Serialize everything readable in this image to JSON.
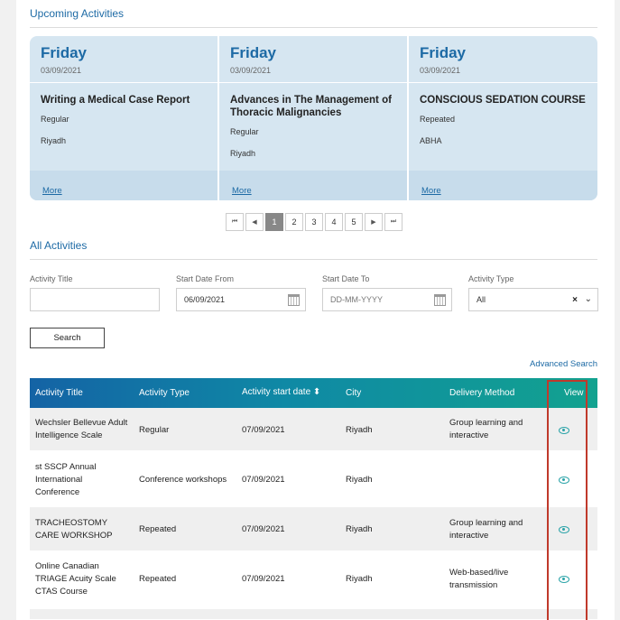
{
  "upcoming": {
    "title": "Upcoming Activities",
    "cards": [
      {
        "day": "Friday",
        "date": "03/09/2021",
        "title": "Writing a Medical Case Report",
        "type": "Regular",
        "city": "Riyadh",
        "more": "More"
      },
      {
        "day": "Friday",
        "date": "03/09/2021",
        "title": "Advances in The Management of Thoracic Malignancies",
        "type": "Regular",
        "city": "Riyadh",
        "more": "More"
      },
      {
        "day": "Friday",
        "date": "03/09/2021",
        "title": "CONSCIOUS SEDATION COURSE",
        "type": "Repeated",
        "city": "ABHA",
        "more": "More"
      }
    ]
  },
  "pagination": {
    "first": "⏮",
    "prev": "◀",
    "pages": [
      "1",
      "2",
      "3",
      "4",
      "5"
    ],
    "active_page": "1",
    "next": "▶",
    "last": "⏭"
  },
  "all": {
    "title": "All Activities",
    "filters": {
      "activity_title_label": "Activity Title",
      "activity_title_value": "",
      "start_from_label": "Start Date From",
      "start_from_value": "06/09/2021",
      "start_to_label": "Start Date To",
      "start_to_placeholder": "DD-MM-YYYY",
      "type_label": "Activity Type",
      "type_value": "All",
      "search_button": "Search",
      "advanced_search": "Advanced Search"
    },
    "table": {
      "headers": [
        "Activity Title",
        "Activity Type",
        "Activity start date ⬍",
        "City",
        "Delivery Method",
        "View"
      ],
      "rows": [
        {
          "title": "Wechsler Bellevue Adult Intelligence Scale",
          "type": "Regular",
          "date": "07/09/2021",
          "city": "Riyadh",
          "delivery": "Group learning and interactive"
        },
        {
          "title": "st SSCP Annual International Conference",
          "type": "Conference workshops",
          "date": "07/09/2021",
          "city": "Riyadh",
          "delivery": ""
        },
        {
          "title": "TRACHEOSTOMY CARE WORKSHOP",
          "type": "Repeated",
          "date": "07/09/2021",
          "city": "Riyadh",
          "delivery": "Group learning and interactive"
        },
        {
          "title": "Online Canadian TRIAGE Acuity Scale CTAS Course",
          "type": "Repeated",
          "date": "07/09/2021",
          "city": "Riyadh",
          "delivery": "Web-based/live transmission"
        }
      ]
    }
  },
  "colors": {
    "accent_blue": "#1d6aa5",
    "card_bg": "#d6e6f1",
    "eye_icon": "#2aa3a8",
    "highlight_border": "#c0392b"
  }
}
